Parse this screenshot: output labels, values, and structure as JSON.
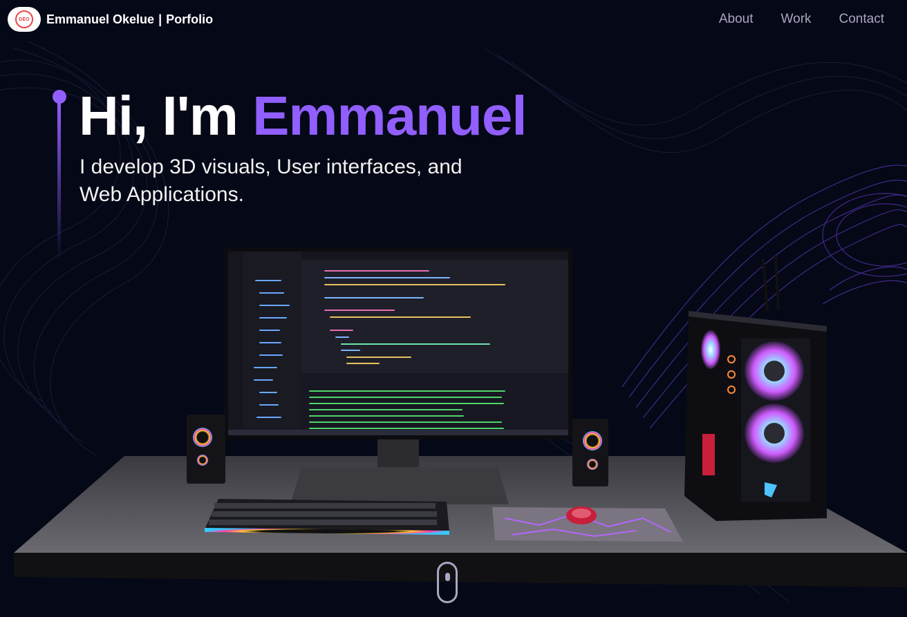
{
  "navbar": {
    "logo_text": "DEO",
    "brand_name": "Emmanuel Okelue",
    "brand_sep": "|",
    "brand_suffix": "Porfolio",
    "links": [
      {
        "label": "About"
      },
      {
        "label": "Work"
      },
      {
        "label": "Contact"
      }
    ]
  },
  "hero": {
    "greeting": "Hi, I'm ",
    "name": "Emmanuel",
    "subtitle": "I develop 3D visuals, User interfaces, and Web Applications."
  },
  "colors": {
    "background": "#050816",
    "accent": "#915eff",
    "nav_text": "#aaa6c3"
  },
  "icons": [
    "mouse-scroll-icon",
    "logo-icon"
  ]
}
